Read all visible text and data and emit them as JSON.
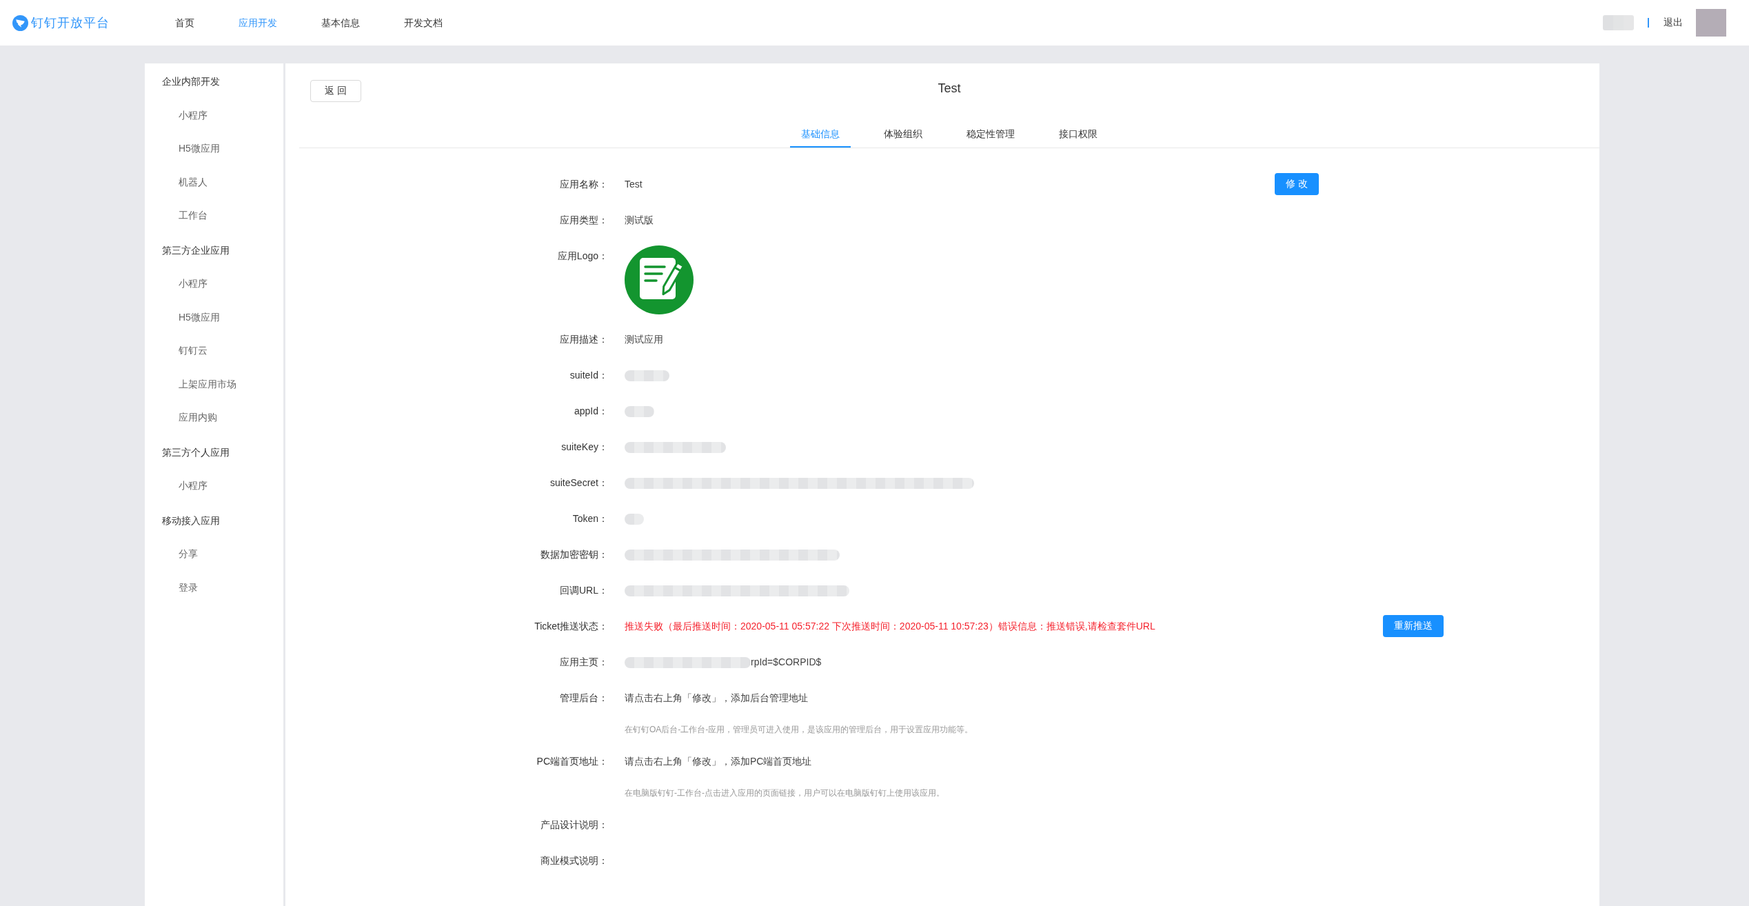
{
  "header": {
    "logo_text": "钉钉开放平台",
    "nav": [
      {
        "label": "首页",
        "selected": false
      },
      {
        "label": "应用开发",
        "selected": true
      },
      {
        "label": "基本信息",
        "selected": false
      },
      {
        "label": "开发文档",
        "selected": false
      }
    ],
    "logout": "退出"
  },
  "sidebar": {
    "groups": [
      {
        "label": "企业内部开发",
        "children": [
          {
            "label": "小程序",
            "selected": false
          },
          {
            "label": "H5微应用",
            "selected": false
          },
          {
            "label": "机器人",
            "selected": false
          },
          {
            "label": "工作台",
            "selected": false
          }
        ]
      },
      {
        "label": "第三方企业应用",
        "children": [
          {
            "label": "小程序",
            "selected": false
          },
          {
            "label": "H5微应用",
            "selected": false
          },
          {
            "label": "钉钉云",
            "selected": false
          },
          {
            "label": "上架应用市场",
            "selected": false
          },
          {
            "label": "应用内购",
            "selected": false
          }
        ]
      },
      {
        "label": "第三方个人应用",
        "children": [
          {
            "label": "小程序",
            "selected": false
          }
        ]
      },
      {
        "label": "移动接入应用",
        "children": [
          {
            "label": "分享",
            "selected": false
          },
          {
            "label": "登录",
            "selected": false
          }
        ]
      }
    ]
  },
  "main": {
    "back_button": "返 回",
    "title": "Test",
    "tabs": [
      {
        "label": "基础信息",
        "selected": true
      },
      {
        "label": "体验组织",
        "selected": false
      },
      {
        "label": "稳定性管理",
        "selected": false
      },
      {
        "label": "接口权限",
        "selected": false
      }
    ],
    "fields": [
      {
        "kind": "text",
        "label": "应用名称：",
        "value": "Test",
        "action": "修 改"
      },
      {
        "kind": "text",
        "label": "应用类型：",
        "value": "测试版"
      },
      {
        "kind": "logo",
        "label": "应用Logo："
      },
      {
        "kind": "text",
        "label": "应用描述：",
        "value": "测试应用"
      },
      {
        "kind": "redacted",
        "label": "suiteId："
      },
      {
        "kind": "redacted",
        "label": "appId："
      },
      {
        "kind": "redacted",
        "label": "suiteKey："
      },
      {
        "kind": "redacted",
        "label": "suiteSecret："
      },
      {
        "kind": "redacted",
        "label": "Token："
      },
      {
        "kind": "redacted",
        "label": "数据加密密钥："
      },
      {
        "kind": "redacted",
        "label": "回调URL："
      },
      {
        "kind": "error",
        "label": "Ticket推送状态：",
        "value": "推送失败（最后推送时间：2020-05-11 05:57:22 下次推送时间：2020-05-11 10:57:23）错误信息：推送错误,请检查套件URL",
        "action": "重新推送"
      },
      {
        "kind": "partly_redacted",
        "label": "应用主页：",
        "value": "rpId=$CORPID$"
      },
      {
        "kind": "hint",
        "label": "管理后台：",
        "value": "请点击右上角「修改」，添加后台管理地址",
        "help": "在钉钉OA后台-工作台-应用，管理员可进入使用，是该应用的管理后台，用于设置应用功能等。"
      },
      {
        "kind": "hint",
        "label": "PC端首页地址：",
        "value": "请点击右上角「修改」，添加PC端首页地址",
        "help": "在电脑版钉钉-工作台-点击进入应用的页面链接，用户可以在电脑版钉钉上使用该应用。"
      },
      {
        "kind": "text",
        "label": "产品设计说明："
      },
      {
        "kind": "text",
        "label": "商业模式说明："
      }
    ]
  }
}
